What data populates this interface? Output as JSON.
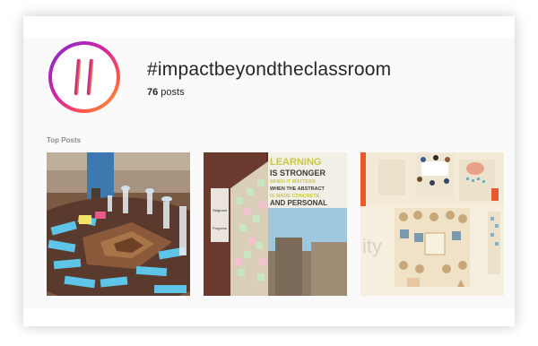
{
  "header": {
    "hashtag": "#impactbeyondtheclassroom",
    "post_count": "76",
    "post_count_suffix": " posts",
    "avatar_icon": "hashtag-icon",
    "avatar_gradient": [
      "#7b2fd4",
      "#d6249f",
      "#fd5949",
      "#fdb52a"
    ]
  },
  "top_posts": {
    "label": "Top Posts",
    "posts": [
      {
        "icon": "classroom-table-photo"
      },
      {
        "icon": "learning-poster-photo",
        "poster_lines": [
          "LEARNING",
          "IS STRONGER",
          "WHEN IT MATTERS",
          "WHEN THE ABSTRACT",
          "IS MADE CONCRETE",
          "AND PERSONAL"
        ],
        "sign_lines": [
          "Stagnant",
          "Progress"
        ]
      },
      {
        "icon": "illustrated-board-photo",
        "fragments": [
          "ity"
        ]
      }
    ]
  }
}
